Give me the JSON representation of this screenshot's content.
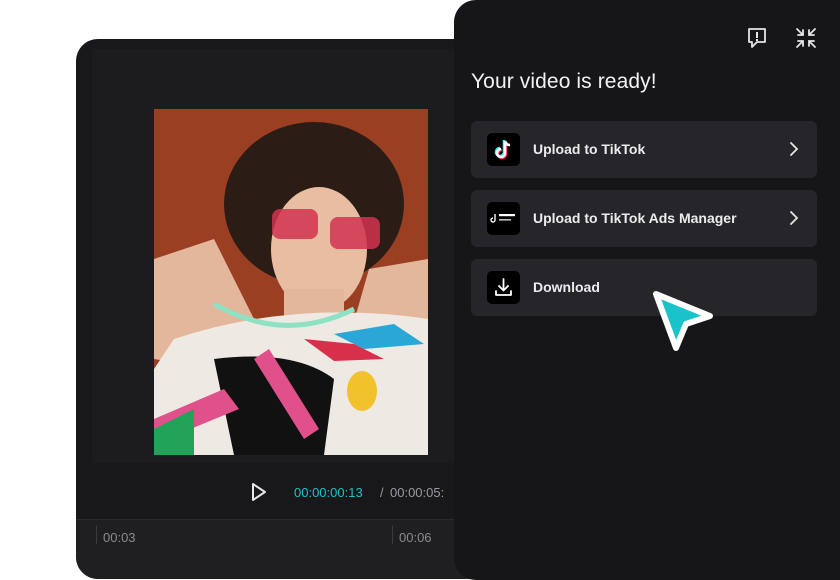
{
  "player": {
    "current_time": "00:00:00:13",
    "separator": "/",
    "total_time": "00:00:05:"
  },
  "timeline": {
    "ticks": [
      "00:03",
      "00:06"
    ]
  },
  "panel": {
    "title": "Your video is ready!",
    "header_icons": [
      "feedback-icon",
      "collapse-icon"
    ],
    "options": [
      {
        "label": "Upload to TikTok",
        "icon": "tiktok-icon"
      },
      {
        "label": "Upload to TikTok Ads Manager",
        "icon": "tiktok-business-icon"
      },
      {
        "label": "Download",
        "icon": "download-icon"
      }
    ]
  },
  "colors": {
    "accent": "#19c3c9",
    "panel_bg": "#161619",
    "option_bg": "#26262a"
  }
}
